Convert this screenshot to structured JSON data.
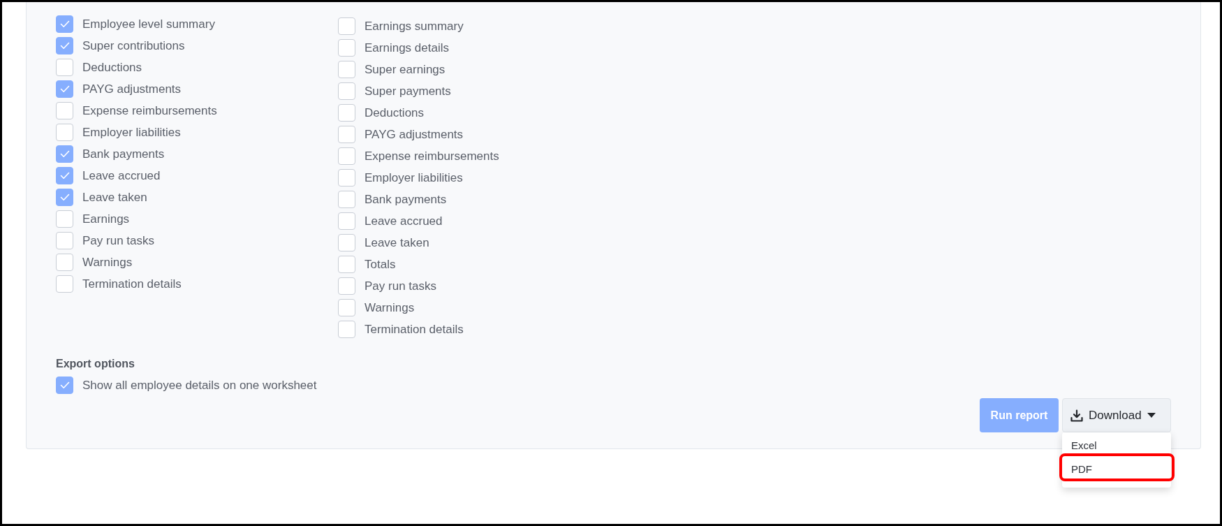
{
  "report_sections": {
    "columns": [
      {
        "items": [
          {
            "label": "Employee level summary",
            "checked": true
          },
          {
            "label": "Super contributions",
            "checked": true
          },
          {
            "label": "Deductions",
            "checked": false
          },
          {
            "label": "PAYG adjustments",
            "checked": true
          },
          {
            "label": "Expense reimbursements",
            "checked": false
          },
          {
            "label": "Employer liabilities",
            "checked": false
          },
          {
            "label": "Bank payments",
            "checked": true
          },
          {
            "label": "Leave accrued",
            "checked": true
          },
          {
            "label": "Leave taken",
            "checked": true
          },
          {
            "label": "Earnings",
            "checked": false
          },
          {
            "label": "Pay run tasks",
            "checked": false
          },
          {
            "label": "Warnings",
            "checked": false
          },
          {
            "label": "Termination details",
            "checked": false
          }
        ]
      },
      {
        "items": [
          {
            "label": "Earnings summary",
            "checked": false
          },
          {
            "label": "Earnings details",
            "checked": false
          },
          {
            "label": "Super earnings",
            "checked": false
          },
          {
            "label": "Super payments",
            "checked": false
          },
          {
            "label": "Deductions",
            "checked": false
          },
          {
            "label": "PAYG adjustments",
            "checked": false
          },
          {
            "label": "Expense reimbursements",
            "checked": false
          },
          {
            "label": "Employer liabilities",
            "checked": false
          },
          {
            "label": "Bank payments",
            "checked": false
          },
          {
            "label": "Leave accrued",
            "checked": false
          },
          {
            "label": "Leave taken",
            "checked": false
          },
          {
            "label": "Totals",
            "checked": false
          },
          {
            "label": "Pay run tasks",
            "checked": false
          },
          {
            "label": "Warnings",
            "checked": false
          },
          {
            "label": "Termination details",
            "checked": false
          }
        ]
      }
    ]
  },
  "export_options": {
    "title": "Export options",
    "items": [
      {
        "label": "Show all employee details on one worksheet",
        "checked": true
      }
    ]
  },
  "actions": {
    "run_report": {
      "label": "Run report"
    },
    "download": {
      "label": "Download",
      "expanded": true,
      "menu": [
        {
          "label": "Excel",
          "highlighted": false
        },
        {
          "label": "PDF",
          "highlighted": true
        }
      ]
    }
  }
}
